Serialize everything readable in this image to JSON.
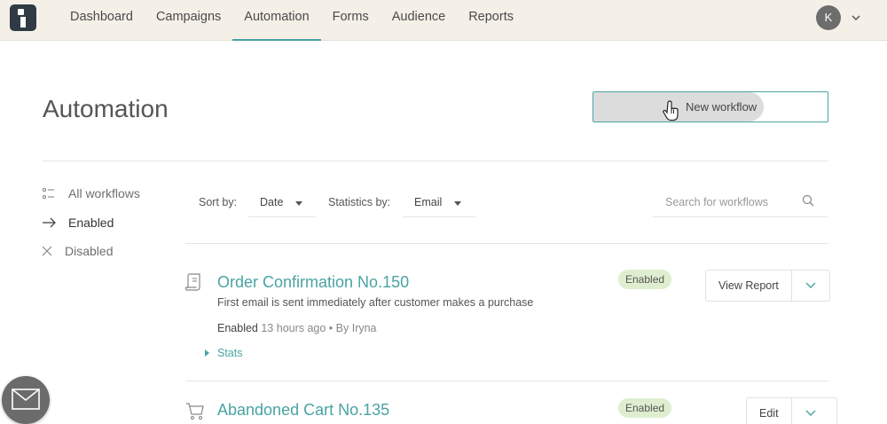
{
  "nav": {
    "items": [
      "Dashboard",
      "Campaigns",
      "Automation",
      "Forms",
      "Audience",
      "Reports"
    ],
    "active": "Automation",
    "avatar_initial": "K"
  },
  "page": {
    "title": "Automation",
    "new_workflow_label": "New workflow"
  },
  "sidebar": {
    "items": [
      {
        "label": "All workflows",
        "icon": "list-icon"
      },
      {
        "label": "Enabled",
        "icon": "arrow-right-icon"
      },
      {
        "label": "Disabled",
        "icon": "x-icon"
      }
    ]
  },
  "filters": {
    "sort_label": "Sort by:",
    "sort_value": "Date",
    "stats_label": "Statistics by:",
    "stats_value": "Email",
    "search_placeholder": "Search for workflows"
  },
  "workflows": [
    {
      "title": "Order Confirmation No.150",
      "description": "First email is sent immediately after customer makes a purchase",
      "status": "Enabled",
      "meta_status": "Enabled",
      "meta_rest": "13 hours ago • By Iryna",
      "stats_label": "Stats",
      "action_label": "View Report",
      "icon": "receipt-icon"
    },
    {
      "title": "Abandoned Cart No.135",
      "status": "Enabled",
      "action_label": "Edit",
      "icon": "cart-icon"
    }
  ],
  "colors": {
    "accent": "#4aa3a3",
    "topbar": "#f4f0e8",
    "badge": "#dfeecf"
  }
}
